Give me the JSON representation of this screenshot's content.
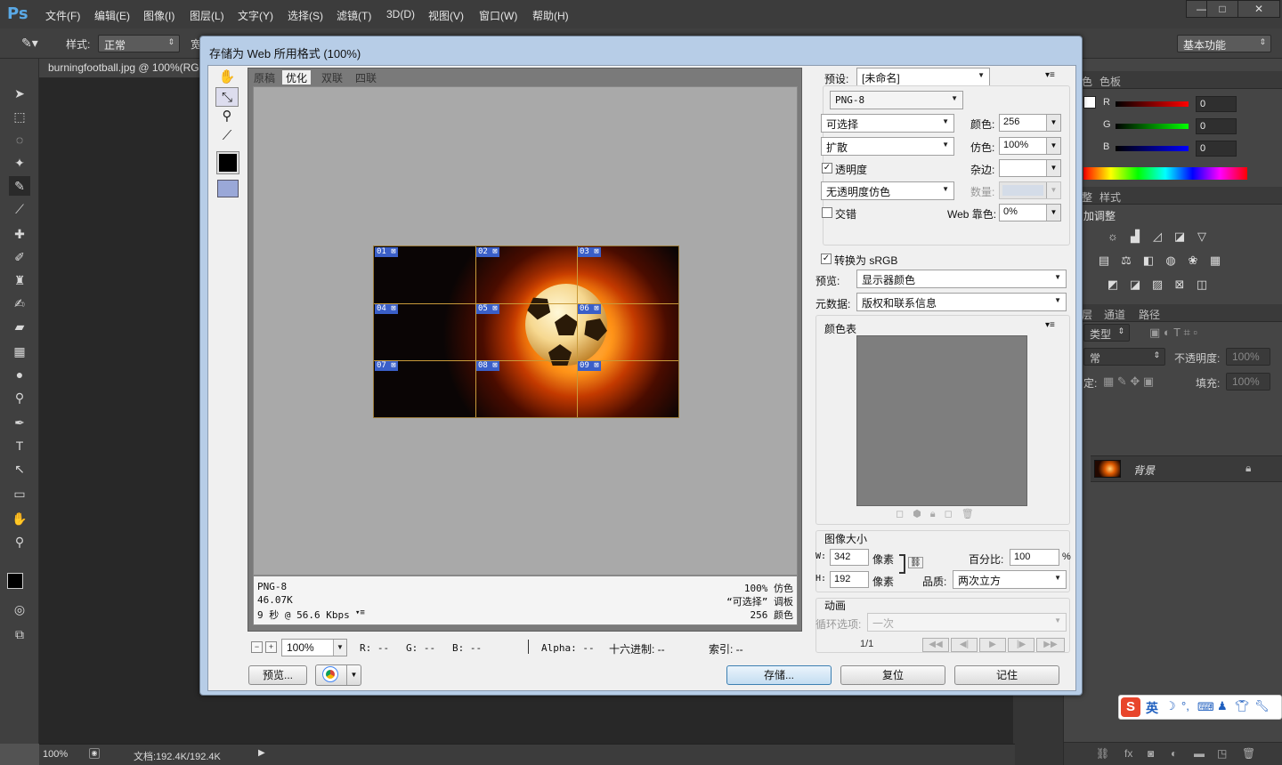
{
  "app": {
    "logo": "Ps",
    "menu": [
      "文件(F)",
      "编辑(E)",
      "图像(I)",
      "图层(L)",
      "文字(Y)",
      "选择(S)",
      "滤镜(T)",
      "3D(D)",
      "视图(V)",
      "窗口(W)",
      "帮助(H)"
    ],
    "window_buttons": [
      "—",
      "□",
      "✕"
    ],
    "options": {
      "style_label": "样式:",
      "style_value": "正常",
      "width_label": "宽",
      "workspace": "基本功能"
    },
    "doc_tab": "burningfootball.jpg @ 100%(RGB/8)",
    "status": {
      "zoom": "100%",
      "doc": "文档:192.4K/192.4K"
    },
    "right_panel": {
      "tabs_top": [
        "色",
        "色板"
      ],
      "rgb": [
        {
          "label": "R",
          "value": "0"
        },
        {
          "label": "G",
          "value": "0"
        },
        {
          "label": "B",
          "value": "0"
        }
      ],
      "adj_tabs": [
        "整",
        "样式"
      ],
      "adj_title": "加调整",
      "layers_tabs": [
        "层",
        "通道",
        "路径"
      ],
      "kind": "类型",
      "blend": "常",
      "opacity_label": "不透明度:",
      "opacity_value": "100%",
      "lock_label": "定:",
      "fill_label": "填充:",
      "fill_value": "100%",
      "layer_name": "背景"
    }
  },
  "dialog": {
    "title": "存储为 Web 所用格式 (100%)",
    "view_tabs": [
      "原稿",
      "优化",
      "双联",
      "四联"
    ],
    "active_tab": "优化",
    "slices": [
      "01",
      "02",
      "03",
      "04",
      "05",
      "06",
      "07",
      "08",
      "09"
    ],
    "info": {
      "format": "PNG-8",
      "size": "46.07K",
      "time": "9 秒 @ 56.6 Kbps",
      "dither": "100% 仿色",
      "palette": "“可选择” 调板",
      "colors": "256 颜色"
    },
    "zoom_value": "100%",
    "readout": {
      "r": "R: --",
      "g": "G: --",
      "b": "B: --",
      "alpha": "Alpha: --",
      "hex": "十六进制: --",
      "index": "索引: --"
    },
    "buttons": {
      "preview": "预览...",
      "save": "存储...",
      "reset": "复位",
      "remember": "记住"
    },
    "settings": {
      "preset_label": "预设:",
      "preset_value": "[未命名]",
      "format": "PNG-8",
      "reduction": "可选择",
      "dither_algo": "扩散",
      "colors_label": "颜色:",
      "colors_value": "256",
      "dither_label": "仿色:",
      "dither_value": "100%",
      "transparency_label": "透明度",
      "transparency_checked": true,
      "matte_label": "杂边:",
      "trans_dither": "无透明度仿色",
      "amount_label": "数量:",
      "interlaced_label": "交错",
      "interlaced_checked": false,
      "websnap_label": "Web 靠色:",
      "websnap_value": "0%",
      "srgb_label": "转换为 sRGB",
      "srgb_checked": true,
      "preview_label": "预览:",
      "preview_value": "显示器颜色",
      "metadata_label": "元数据:",
      "metadata_value": "版权和联系信息",
      "color_table_label": "颜色表",
      "image_size_label": "图像大小",
      "w_label": "W:",
      "w_value": "342",
      "h_label": "H:",
      "h_value": "192",
      "px_unit": "像素",
      "percent_label": "百分比:",
      "percent_value": "100",
      "percent_unit": "%",
      "quality_label": "品质:",
      "quality_value": "两次立方",
      "animation_label": "动画",
      "loop_label": "循环选项:",
      "loop_value": "一次",
      "frame": "1/1"
    }
  },
  "ime": {
    "lang": "英"
  }
}
